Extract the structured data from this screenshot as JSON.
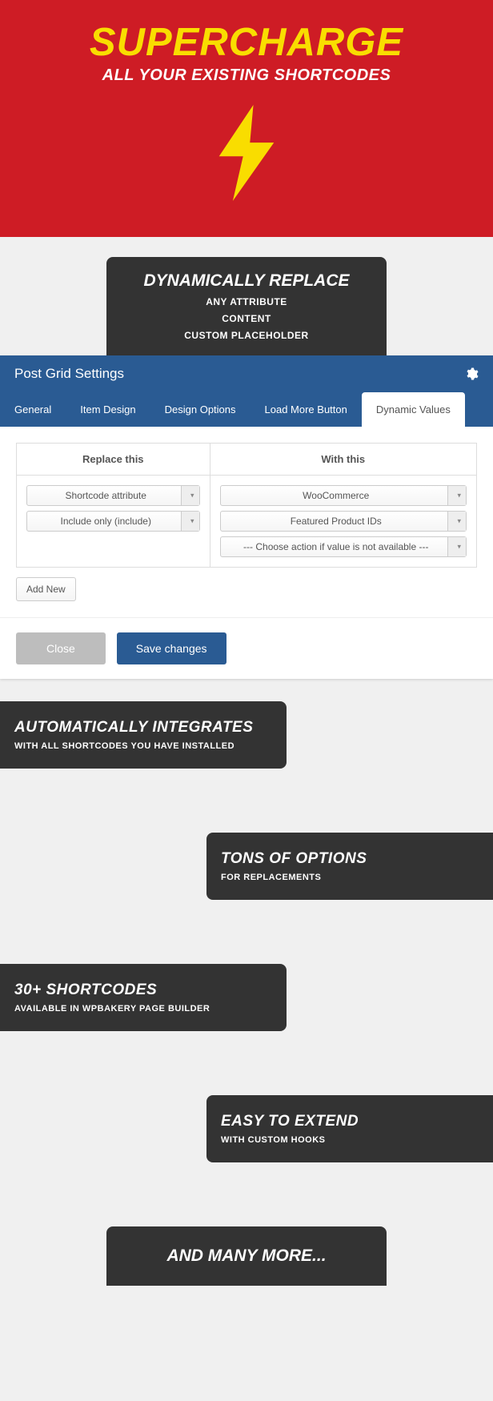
{
  "hero": {
    "title": "SUPERCHARGE",
    "subtitle": "ALL YOUR EXISTING SHORTCODES"
  },
  "intro": {
    "title": "DYNAMICALLY REPLACE",
    "lines": [
      "ANY ATTRIBUTE",
      "CONTENT",
      "CUSTOM PLACEHOLDER"
    ]
  },
  "panel": {
    "title": "Post Grid Settings",
    "tabs": [
      "General",
      "Item Design",
      "Design Options",
      "Load More Button",
      "Dynamic Values"
    ],
    "activeTab": 4,
    "columns": {
      "left": "Replace this",
      "right": "With this"
    },
    "leftSelects": [
      "Shortcode attribute",
      "Include only (include)"
    ],
    "rightSelects": [
      "WooCommerce",
      "Featured Product IDs",
      "--- Choose action if value is not available ---"
    ],
    "addNew": "Add New",
    "close": "Close",
    "save": "Save changes"
  },
  "features": [
    {
      "title": "AUTOMATICALLY INTEGRATES",
      "sub": "WITH ALL SHORTCODES YOU HAVE INSTALLED"
    },
    {
      "title": "TONS OF OPTIONS",
      "sub": "FOR REPLACEMENTS"
    },
    {
      "title": "30+ SHORTCODES",
      "sub": "AVAILABLE IN WPBAKERY PAGE BUILDER"
    },
    {
      "title": "EASY TO EXTEND",
      "sub": "WITH CUSTOM HOOKS"
    }
  ],
  "more": "AND MANY MORE..."
}
